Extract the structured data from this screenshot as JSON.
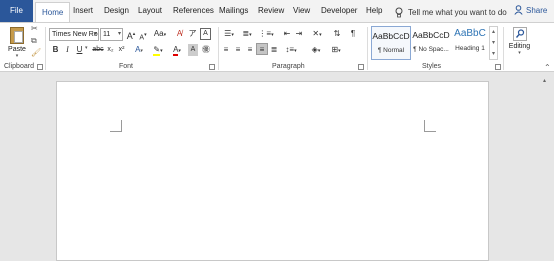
{
  "tabs": {
    "file": "File",
    "home": "Home",
    "insert": "Insert",
    "design": "Design",
    "layout": "Layout",
    "references": "References",
    "mailings": "Mailings",
    "review": "Review",
    "view": "View",
    "developer": "Developer",
    "help": "Help"
  },
  "tell_me": "Tell me what you want to do",
  "share": "Share",
  "clipboard": {
    "paste": "Paste",
    "label": "Clipboard"
  },
  "font": {
    "family": "Times New Ro",
    "size": "11",
    "grow": "A",
    "shrink": "A",
    "case": "Aa",
    "bold": "B",
    "italic": "I",
    "underline": "U",
    "strike": "abc",
    "subscript": "x₂",
    "superscript": "x²",
    "label": "Font"
  },
  "paragraph": {
    "label": "Paragraph"
  },
  "styles": {
    "label": "Styles",
    "items": [
      {
        "sample": "AaBbCcD",
        "name": "¶ Normal"
      },
      {
        "sample": "AaBbCcD",
        "name": "¶ No Spac..."
      },
      {
        "sample": "AaBbC",
        "name": "Heading 1"
      }
    ]
  },
  "editing": {
    "label": "Editing"
  },
  "colors": {
    "accent": "#2b579a",
    "heading": "#2e74b5"
  }
}
